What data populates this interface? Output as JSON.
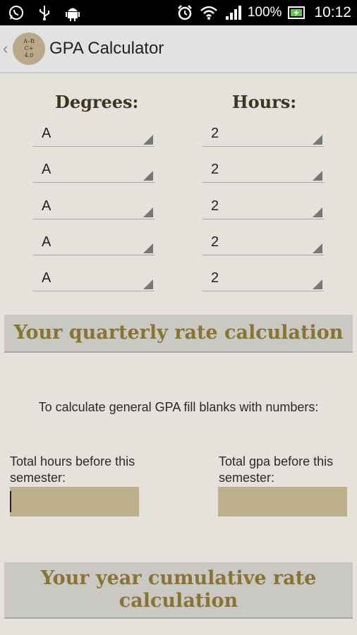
{
  "status_bar": {
    "battery": "100%",
    "time": "10:12",
    "left_icons": [
      "whatsapp-icon",
      "usb-icon",
      "android-icon"
    ],
    "right_icons": [
      "alarm-icon",
      "wifi-icon",
      "signal-icon",
      "battery-icon"
    ]
  },
  "action_bar": {
    "title": "GPA Calculator",
    "logo_lines": [
      "A–B",
      "C+",
      "4.0"
    ]
  },
  "headers": {
    "degrees": "Degrees:",
    "hours": "Hours:"
  },
  "rows": [
    {
      "degree": "A",
      "hours": "2"
    },
    {
      "degree": "A",
      "hours": "2"
    },
    {
      "degree": "A",
      "hours": "2"
    },
    {
      "degree": "A",
      "hours": "2"
    },
    {
      "degree": "A",
      "hours": "2"
    }
  ],
  "buttons": {
    "quarterly": "Your quarterly rate calculation",
    "year": "Your year cumulative rate calculation"
  },
  "instruction": "To calculate general GPA fill blanks with numbers:",
  "fields": {
    "total_hours_label": "Total hours before this semester:",
    "total_hours_value": "",
    "total_gpa_label": "Total gpa before this semester:",
    "total_gpa_value": ""
  },
  "colors": {
    "background": "#e5e2dc",
    "accent_text": "#8a7434",
    "field_fill": "#bdaf89",
    "header_text": "#3e3420"
  }
}
